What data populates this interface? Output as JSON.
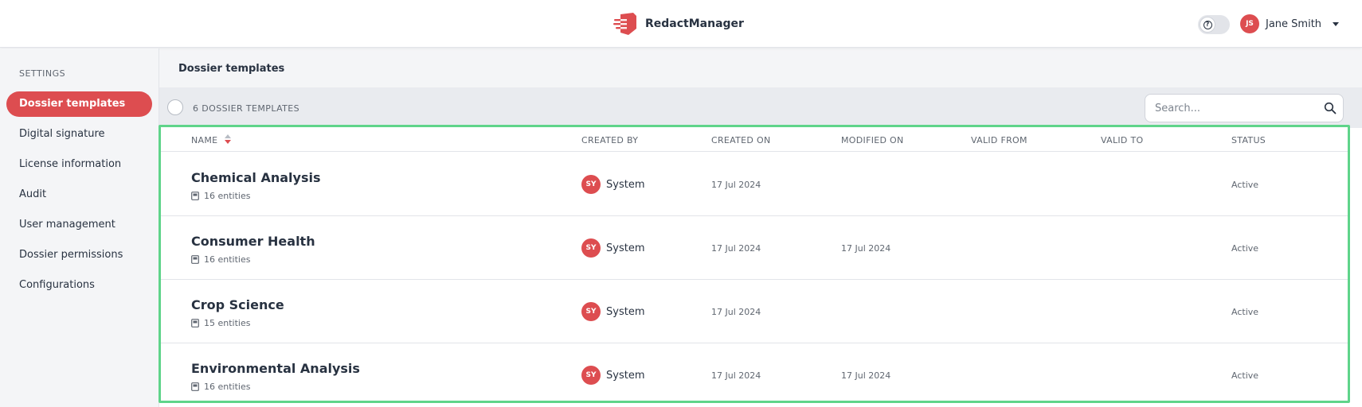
{
  "header": {
    "brand_name": "RedactManager",
    "user_initials": "JS",
    "user_name": "Jane Smith"
  },
  "sidebar": {
    "heading": "SETTINGS",
    "items": [
      {
        "label": "Dossier templates",
        "active": true
      },
      {
        "label": "Digital signature",
        "active": false
      },
      {
        "label": "License information",
        "active": false
      },
      {
        "label": "Audit",
        "active": false
      },
      {
        "label": "User management",
        "active": false
      },
      {
        "label": "Dossier permissions",
        "active": false
      },
      {
        "label": "Configurations",
        "active": false
      }
    ]
  },
  "main": {
    "title": "Dossier templates",
    "count_label": "6 DOSSIER TEMPLATES",
    "search_placeholder": "Search...",
    "columns": [
      "NAME",
      "CREATED BY",
      "CREATED ON",
      "MODIFIED ON",
      "VALID FROM",
      "VALID TO",
      "STATUS"
    ],
    "rows": [
      {
        "name": "Chemical Analysis",
        "entities": "16 entities",
        "creator_initials": "SY",
        "creator": "System",
        "created_on": "17 Jul 2024",
        "modified_on": "",
        "valid_from": "",
        "valid_to": "",
        "status": "Active"
      },
      {
        "name": "Consumer Health",
        "entities": "16 entities",
        "creator_initials": "SY",
        "creator": "System",
        "created_on": "17 Jul 2024",
        "modified_on": "17 Jul 2024",
        "valid_from": "",
        "valid_to": "",
        "status": "Active"
      },
      {
        "name": "Crop Science",
        "entities": "15 entities",
        "creator_initials": "SY",
        "creator": "System",
        "created_on": "17 Jul 2024",
        "modified_on": "",
        "valid_from": "",
        "valid_to": "",
        "status": "Active"
      },
      {
        "name": "Environmental Analysis",
        "entities": "16 entities",
        "creator_initials": "SY",
        "creator": "System",
        "created_on": "17 Jul 2024",
        "modified_on": "17 Jul 2024",
        "valid_from": "",
        "valid_to": "",
        "status": "Active"
      }
    ]
  },
  "colors": {
    "accent": "#dd4d50",
    "highlight_frame": "#5fd48a"
  }
}
